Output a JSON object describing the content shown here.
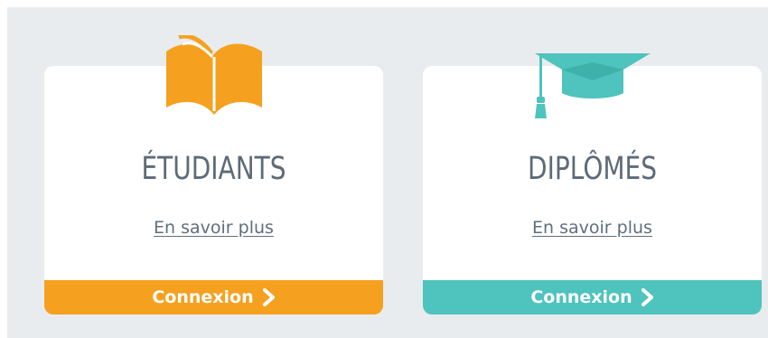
{
  "colors": {
    "students_accent": "#f5a11f",
    "graduates_accent": "#4fc3bd",
    "title_text": "#5d6b78",
    "background_panel": "#e9ecef"
  },
  "cards": [
    {
      "icon": "open-book-icon",
      "title": "ÉTUDIANTS",
      "link_label": "En savoir plus",
      "button_label": "Connexion",
      "button_icon": "chevron-right-icon"
    },
    {
      "icon": "graduation-cap-icon",
      "title": "DIPLÔMÉS",
      "link_label": "En savoir plus",
      "button_label": "Connexion",
      "button_icon": "chevron-right-icon"
    }
  ]
}
